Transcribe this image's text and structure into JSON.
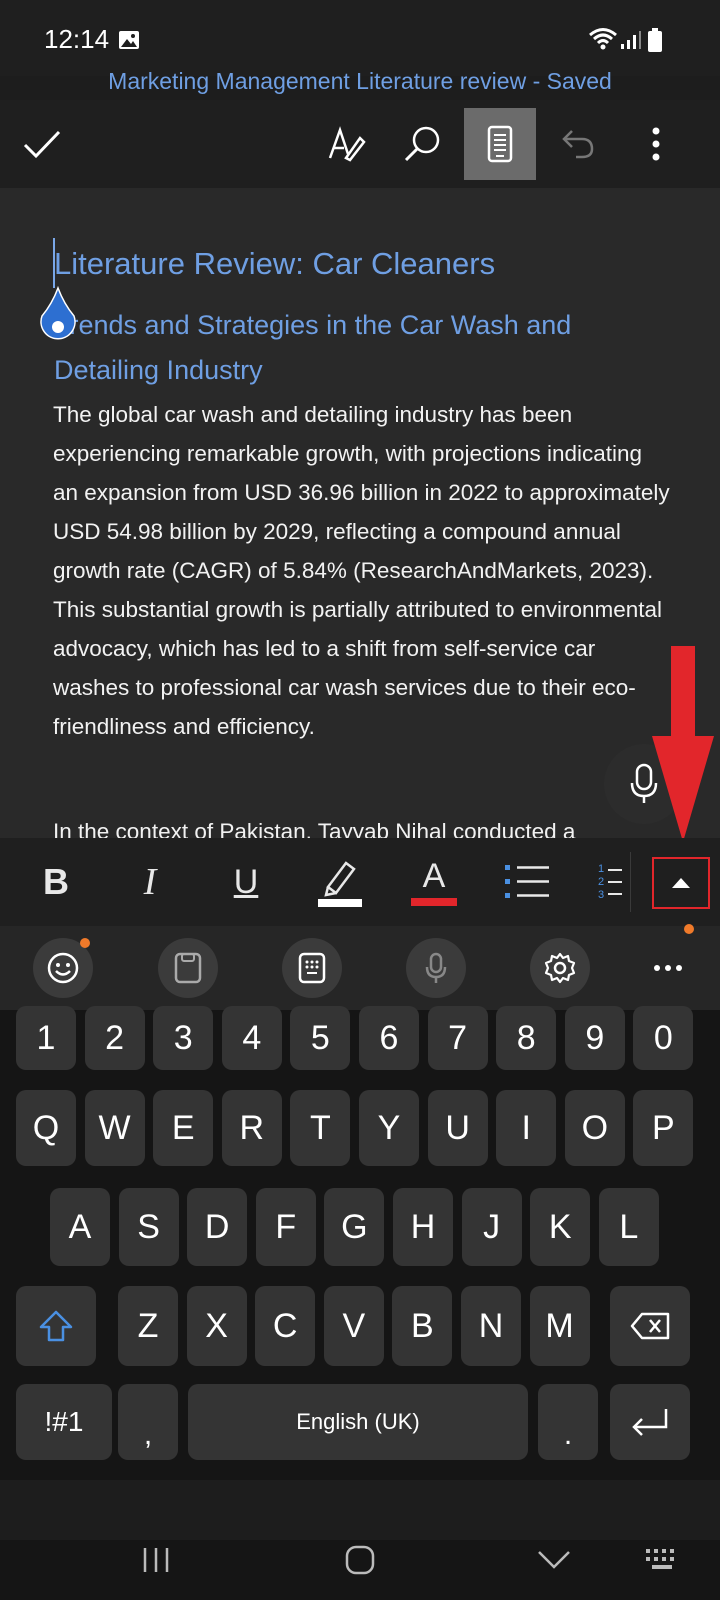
{
  "status_bar": {
    "time": "12:14"
  },
  "title": "Marketing Management Literature review - Saved",
  "toolbar": {
    "icons": [
      "check-icon",
      "draw-pen-icon",
      "search-icon",
      "mobile-view-icon",
      "undo-icon",
      "more-vert-icon"
    ]
  },
  "document": {
    "heading1": "Literature Review: Car Cleaners",
    "heading2": "Trends and Strategies in the Car Wash and Detailing Industry",
    "paragraph1": "The global car wash and detailing industry has been experiencing remarkable growth, with projections indicating an expansion from USD 36.96 billion in 2022 to approximately USD 54.98 billion by 2029, reflecting a compound annual growth rate (CAGR) of 5.84% (ResearchAndMarkets, 2023). This substantial growth is partially attributed to environmental advocacy, which has led to a shift from self-service car washes to professional car wash services due to their eco-friendliness and efficiency.",
    "paragraph2": "In the context of Pakistan, Tayyab Nihal conducted a"
  },
  "format_bar": {
    "bold": "B",
    "italic": "I",
    "underline": "U",
    "font_color_letter": "A",
    "highlight_color": "#ffffff",
    "font_color": "#e2262b",
    "numbered_list_digits": [
      "1",
      "2",
      "3"
    ]
  },
  "keyboard_toolbar": {
    "icons": [
      "emoji-icon",
      "clipboard-icon",
      "keypad-icon",
      "mic-icon",
      "settings-icon",
      "more-horiz-icon"
    ]
  },
  "keyboard": {
    "row_numbers": [
      "1",
      "2",
      "3",
      "4",
      "5",
      "6",
      "7",
      "8",
      "9",
      "0"
    ],
    "row1": [
      "Q",
      "W",
      "E",
      "R",
      "T",
      "Y",
      "U",
      "I",
      "O",
      "P"
    ],
    "row2": [
      "A",
      "S",
      "D",
      "F",
      "G",
      "H",
      "J",
      "K",
      "L"
    ],
    "row3": [
      "Z",
      "X",
      "C",
      "V",
      "B",
      "N",
      "M"
    ],
    "symbols_key": "!#1",
    "comma_key": ",",
    "space_label": "English (UK)",
    "period_key": "."
  },
  "colors": {
    "accent_blue": "#6f9fe3",
    "annotation_red": "#e2262b"
  }
}
